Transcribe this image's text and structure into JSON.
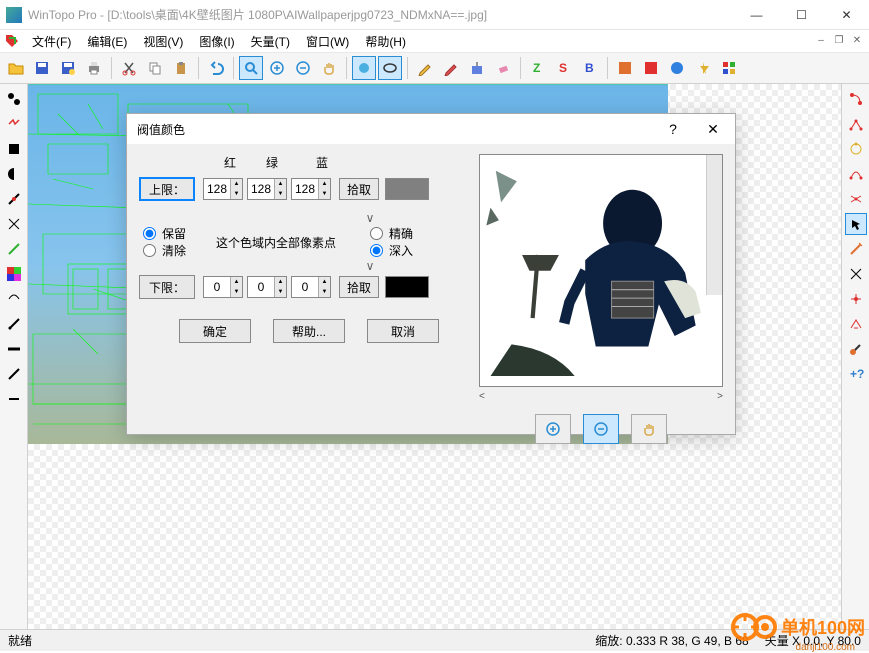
{
  "title": "WinTopo Pro - [D:\\tools\\桌面\\4K壁纸图片 1080P\\AIWallpaperjpg0723_NDMxNA==.jpg]",
  "menu": {
    "file": "文件(F)",
    "edit": "编辑(E)",
    "view": "视图(V)",
    "image": "图像(I)",
    "vector": "矢量(T)",
    "window": "窗口(W)",
    "help": "帮助(H)"
  },
  "status": {
    "ready": "就绪",
    "zoom": "缩放: 0.333 R 38, G 49, B 68",
    "vector": "矢量 X 0.0, Y 80.0"
  },
  "dialog": {
    "title": "阀值颜色",
    "headers": {
      "red": "红",
      "green": "绿",
      "blue": "蓝"
    },
    "upper_btn": "上限：",
    "lower_btn": "下限：",
    "upper": {
      "r": "128",
      "g": "128",
      "b": "128"
    },
    "lower": {
      "r": "0",
      "g": "0",
      "b": "0"
    },
    "pick": "拾取",
    "keep": "保留",
    "clear": "清除",
    "range_text": "这个色域内全部像素点",
    "precise": "精确",
    "deep": "深入",
    "ok": "确定",
    "help_btn": "帮助...",
    "cancel": "取消",
    "swatch_upper": "#808080",
    "swatch_lower": "#000000"
  },
  "watermark": {
    "main": "单机100网",
    "sub": "danji100.com"
  }
}
